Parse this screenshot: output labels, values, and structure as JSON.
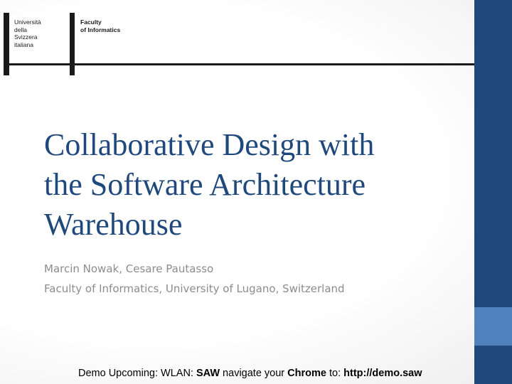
{
  "logo": {
    "university_lines": [
      "Università",
      "della",
      "Svizzera",
      "italiana"
    ],
    "faculty_lines": [
      "Faculty",
      "of Informatics"
    ]
  },
  "title": {
    "lines": [
      "Collaborative Design with",
      "the Software Architecture",
      "Warehouse"
    ]
  },
  "authors": "Marcin Nowak, Cesare Pautasso",
  "affiliation": "Faculty of Informatics, University of Lugano, Switzerland",
  "footer": {
    "prefix": "Demo Upcoming: WLAN: ",
    "wlan_name": "SAW",
    "middle": " navigate your ",
    "browser": "Chrome",
    "to": " to: ",
    "url": "http://demo.saw"
  },
  "colors": {
    "title": "#1f497d",
    "right_bar": "#1f497d",
    "right_bar_accent": "#4f81bd",
    "subtitle": "#8c8c8c"
  }
}
